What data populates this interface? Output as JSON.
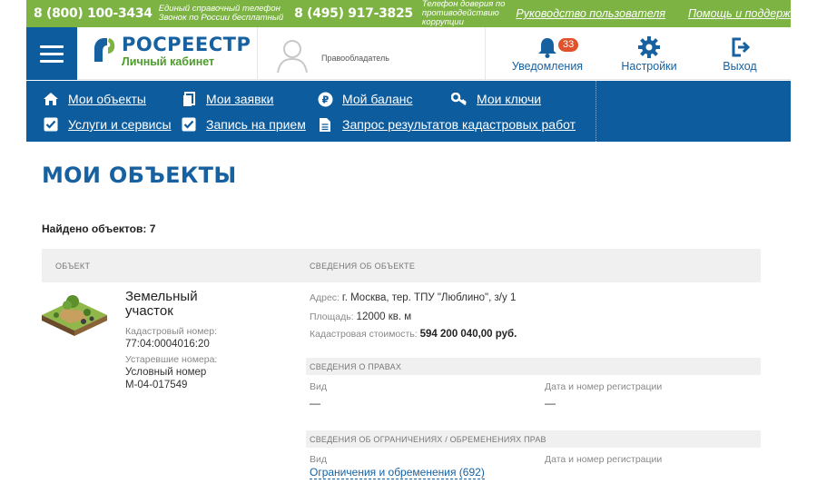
{
  "topbar": {
    "phone1": "8 (800) 100-3434",
    "phone1_note_line1": "Единый справочный телефон",
    "phone1_note_line2": "Звонок по России бесплатный",
    "phone2": "8 (495) 917-3825",
    "phone2_note_line1": "Телефон доверия по",
    "phone2_note_line2": "противодействию",
    "phone2_note_line3": "коррупции",
    "link_manual": "Руководство пользователя",
    "link_help": "Помощь и поддержка",
    "color": "#7cb342"
  },
  "header": {
    "brand": "РОСРЕЕСТР",
    "brand_sub": "Личный кабинет",
    "owner_label": "Правообладатель",
    "notifications_label": "Уведомления",
    "notifications_count": "33",
    "settings_label": "Настройки",
    "logout_label": "Выход"
  },
  "nav": {
    "items": [
      {
        "label": "Мои объекты",
        "icon": "home-icon"
      },
      {
        "label": "Мои заявки",
        "icon": "document-icon"
      },
      {
        "label": "Мой баланс",
        "icon": "ruble-coin-icon"
      },
      {
        "label": "Мои ключи",
        "icon": "key-icon"
      },
      {
        "label": "Услуги и сервисы",
        "icon": "checkbox-icon"
      },
      {
        "label": "Запись на прием",
        "icon": "checkbox-icon"
      },
      {
        "label": "Запрос результатов кадастровых работ",
        "icon": "document-lines-icon"
      }
    ],
    "color": "#0d5c9e"
  },
  "page": {
    "title": "МОИ ОБЪЕКТЫ",
    "found": "Найдено объектов: 7"
  },
  "table": {
    "col_object": "ОБЪЕКТ",
    "col_info": "СВЕДЕНИЯ ОБ ОБЪЕКТЕ",
    "rows": [
      {
        "type_line1": "Земельный",
        "type_line2": "участок",
        "cadastral_label": "Кадастровый номер:",
        "cadastral_value": "77:04:0004016:20",
        "old_numbers_label": "Устаревшие номера:",
        "old_numbers_line1": "Условный номер",
        "old_numbers_line2": "М-04-017549",
        "address_label": "Адрес:",
        "address_value": "г. Москва, тер. ТПУ \"Люблино\", з/у 1",
        "area_label": "Площадь:",
        "area_value": "12000 кв. м",
        "cost_label": "Кадастровая стоимость:",
        "cost_value": "594 200 040,00 руб.",
        "rights_header": "СВЕДЕНИЯ О ПРАВАХ",
        "rights_kind_label": "Вид",
        "rights_kind_value": "—",
        "rights_reg_label": "Дата и номер регистрации",
        "rights_reg_value": "—",
        "restrictions_header": "СВЕДЕНИЯ ОБ ОГРАНИЧЕНИЯХ / ОБРЕМЕНЕНИЯХ ПРАВ",
        "restrictions_kind_label": "Вид",
        "restrictions_reg_label": "Дата и номер регистрации",
        "restrictions_link": "Ограничения и обременения (692)"
      }
    ]
  }
}
